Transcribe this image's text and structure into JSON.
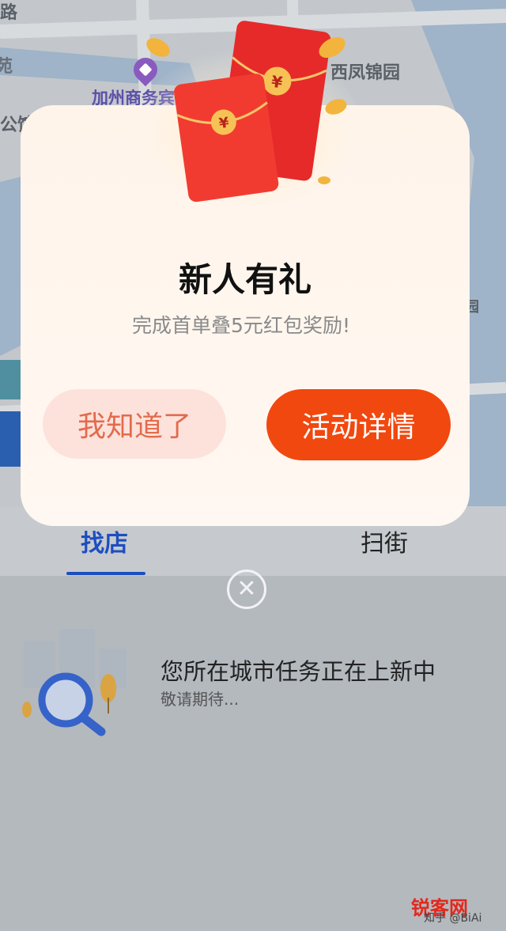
{
  "map": {
    "labels": {
      "road": "路",
      "district": "苑",
      "hotel_partial": "公馆",
      "poi": "加州商务宾馆",
      "garden": "西凤锦园",
      "right_edge": "园"
    }
  },
  "dialog": {
    "title": "新人有礼",
    "subtitle": "完成首单叠5元红包奖励!",
    "secondary_button": "我知道了",
    "primary_button": "活动详情",
    "image": "red-envelope-coins"
  },
  "tabs": [
    {
      "label": "找店",
      "active": true
    },
    {
      "label": "扫街",
      "active": false
    }
  ],
  "close_icon": "close-circle-icon",
  "empty_state": {
    "title": "您所在城市任务正在上新中",
    "subtitle": "敬请期待..."
  },
  "watermark": {
    "logo": "锐客网",
    "small": "知乎 @BiAi"
  },
  "colors": {
    "primary": "#f1480f",
    "secondary_bg": "#fde2dc",
    "secondary_text": "#e26b4c",
    "tab_active": "#1d4ec0"
  }
}
